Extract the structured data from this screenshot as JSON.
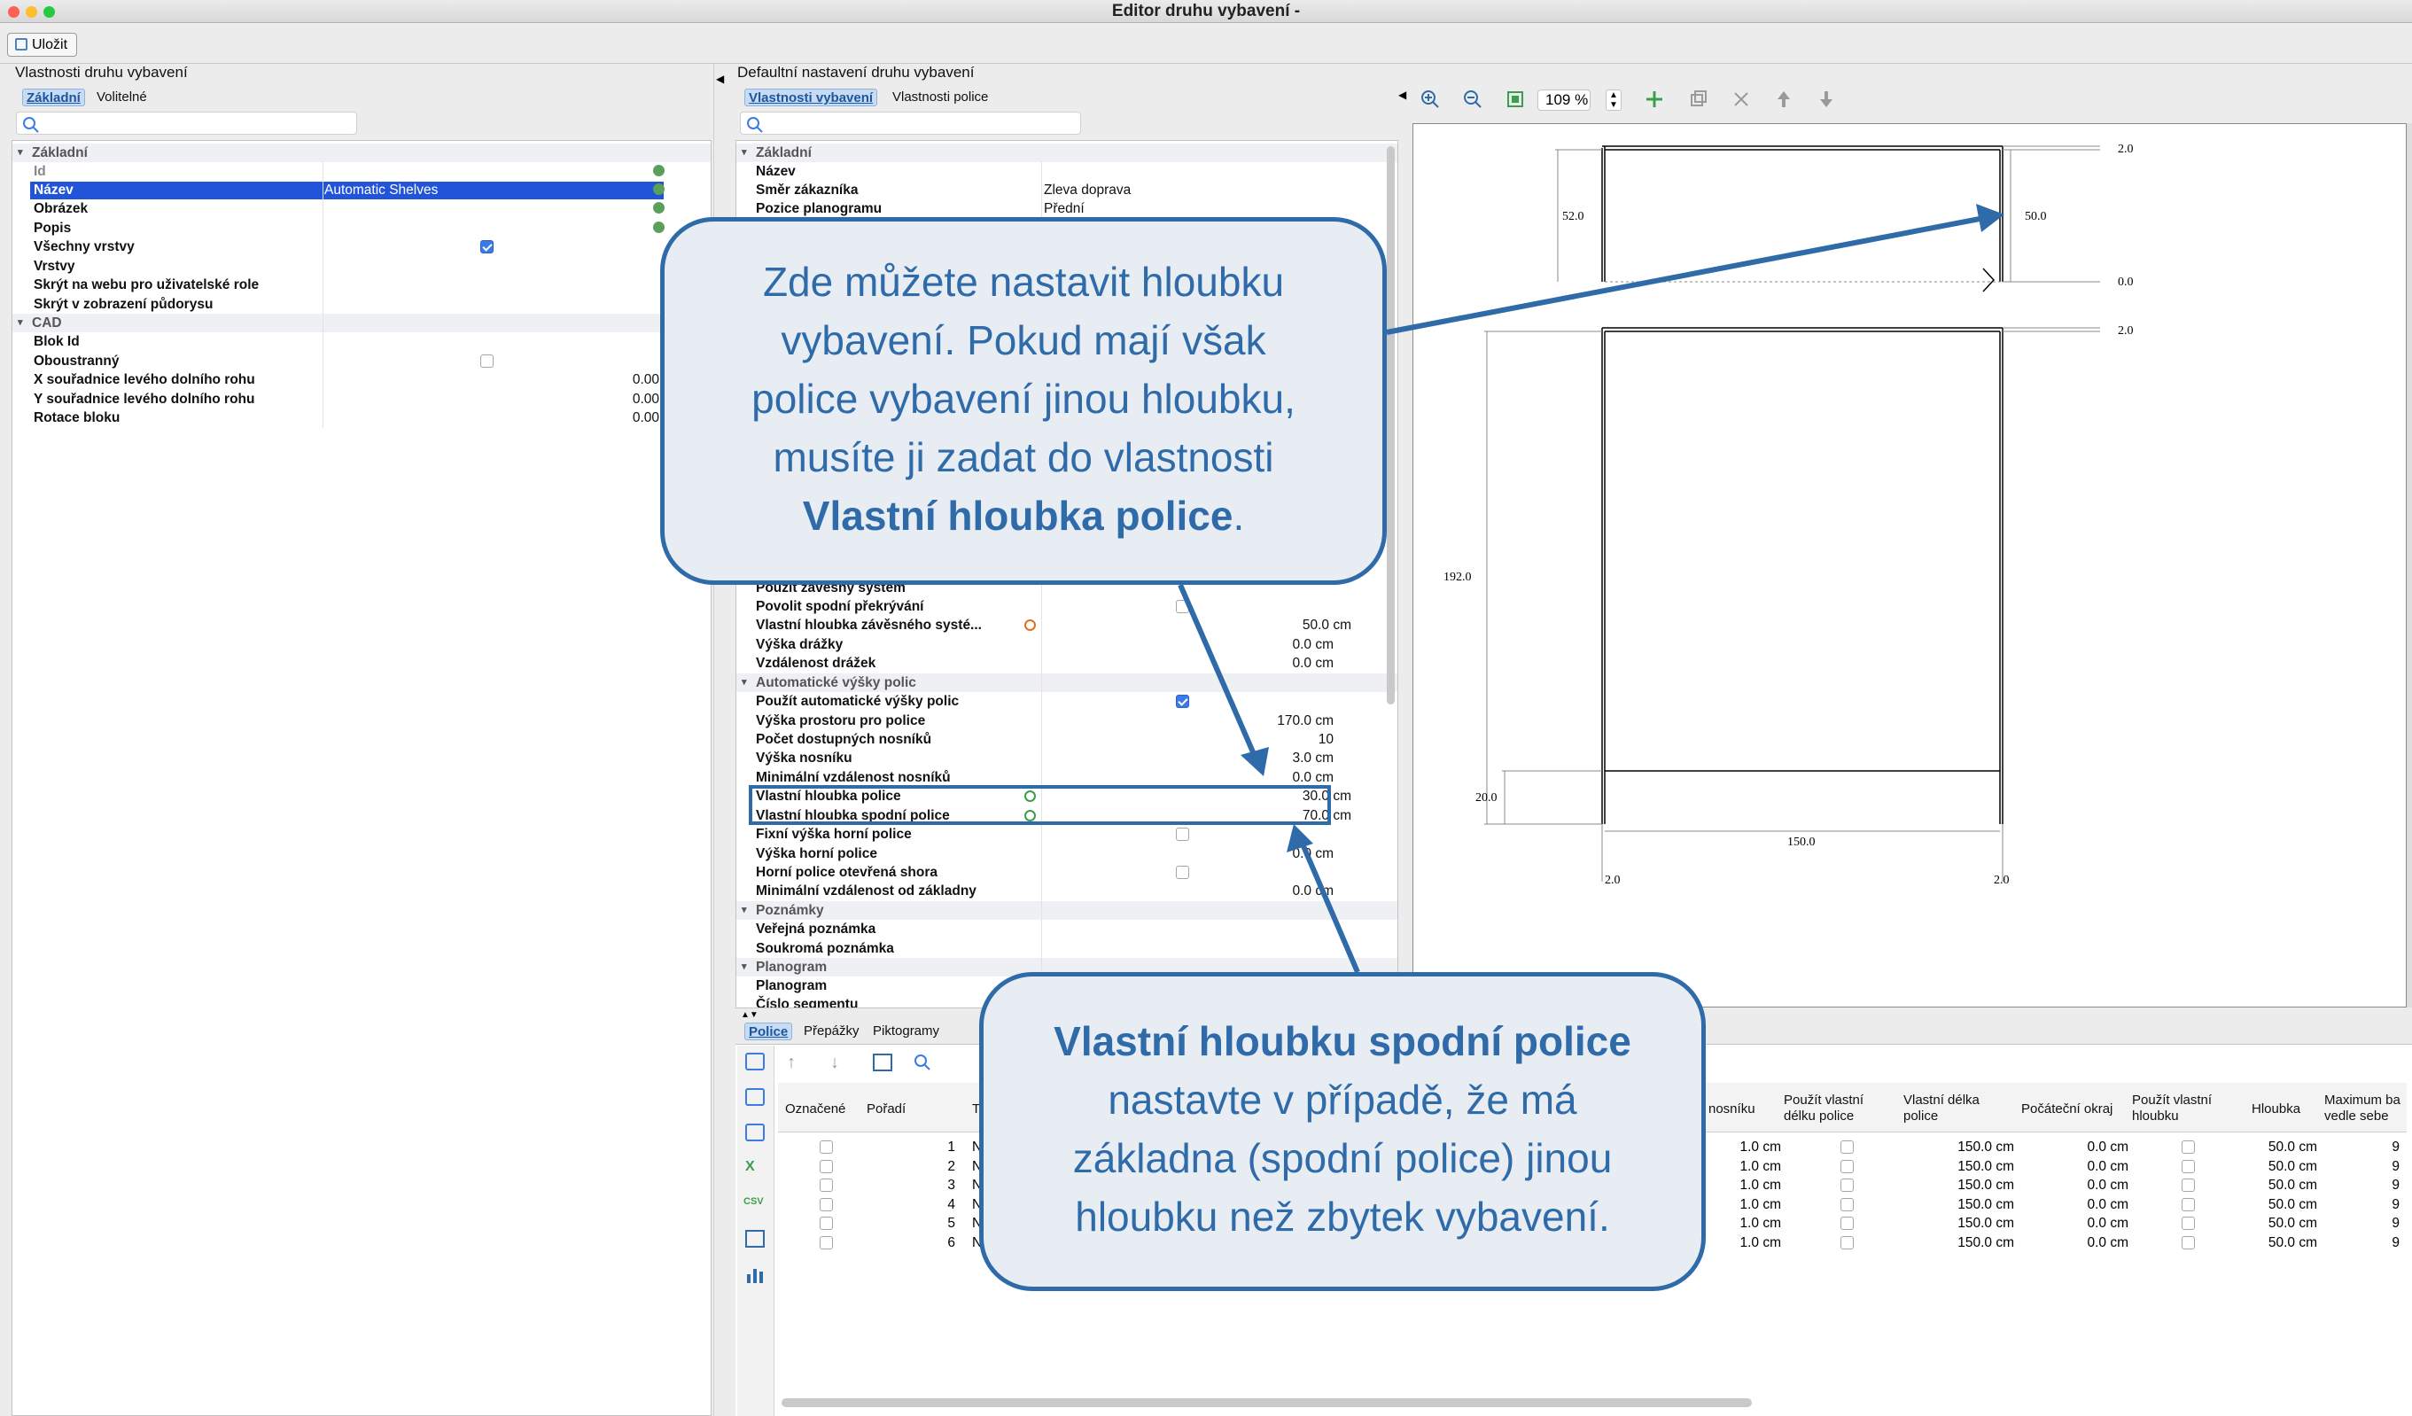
{
  "window": {
    "title": "Editor druhu vybavení -"
  },
  "toolbar": {
    "save_label": "Uložit"
  },
  "left": {
    "title": "Vlastnosti druhu vybavení",
    "tabs": [
      "Základní",
      "Volitelné"
    ],
    "groups": {
      "basic": "Základní",
      "cad": "CAD"
    },
    "rows": {
      "id": "Id",
      "name": "Název",
      "name_value": "Automatic Shelves",
      "image": "Obrázek",
      "desc": "Popis",
      "all_layers": "Všechny vrstvy",
      "layers": "Vrstvy",
      "hide_web": "Skrýt na webu pro uživatelské role",
      "hide_plan": "Skrýt v zobrazení půdorysu",
      "block_id": "Blok Id",
      "double_sided": "Oboustranný",
      "x_coord": "X souřadnice levého dolního rohu",
      "x_value": "0.00",
      "y_coord": "Y souřadnice levého dolního rohu",
      "y_value": "0.00",
      "rotation": "Rotace bloku",
      "rotation_value": "0.00"
    }
  },
  "middle": {
    "title": "Defaultní nastavení druhu vybavení",
    "tabs": [
      "Vlastnosti vybavení",
      "Vlastnosti police"
    ],
    "groups": {
      "basic": "Základní",
      "auto": "Automatické výšky polic",
      "notes": "Poznámky",
      "planogram": "Planogram"
    },
    "rows": {
      "name": "Název",
      "direction": "Směr zákazníka",
      "direction_value": "Zleva doprava",
      "position": "Pozice planogramu",
      "position_value": "Přední",
      "hanging_use": "Použít závěsný systém",
      "allow_overlap": "Povolit spodní překrývání",
      "own_depth_hanging": "Vlastní hloubka závěsného systé...",
      "own_depth_hanging_value": "50.0 cm",
      "groove_height": "Výška drážky",
      "groove_height_value": "0.0 cm",
      "groove_dist": "Vzdálenost drážek",
      "groove_dist_value": "0.0 cm",
      "use_auto": "Použít automatické výšky polic",
      "space_height": "Výška prostoru pro police",
      "space_height_value": "170.0 cm",
      "beams_count": "Počet dostupných nosníků",
      "beams_count_value": "10",
      "beam_height": "Výška nosníku",
      "beam_height_value": "3.0 cm",
      "min_beam_dist": "Minimální vzdálenost nosníků",
      "min_beam_dist_value": "0.0 cm",
      "shelf_depth": "Vlastní hloubka police",
      "shelf_depth_value": "30.0 cm",
      "bottom_depth": "Vlastní hloubka spodní police",
      "bottom_depth_value": "70.0 cm",
      "fixed_top": "Fixní výška horní police",
      "top_height": "Výška horní police",
      "top_height_value": "0.0 cm",
      "top_open": "Horní police otevřená shora",
      "min_base": "Minimální vzdálenost od základny",
      "min_base_value": "0.0 cm",
      "public_note": "Veřejná poznámka",
      "private_note": "Soukromá poznámka",
      "planogram": "Planogram",
      "segment": "Číslo segmentu"
    }
  },
  "viewer": {
    "zoom": "109 %",
    "dims": {
      "d1": "2.0",
      "d2": "52.0",
      "d3": "50.0",
      "d4": "0.0",
      "d5": "2.0",
      "d6": "192.0",
      "d7": "20.0",
      "d8": "150.0",
      "d9": "2.0",
      "d10": "2.0"
    }
  },
  "bottom": {
    "tabs": [
      "Police",
      "Přepážky",
      "Piktogramy"
    ],
    "columns": {
      "marked": "Označené",
      "order": "Pořadí",
      "t": "T",
      "beam": "nosníku",
      "use_len": "Použít vlastní délku police",
      "own_len": "Vlastní délka police",
      "start_edge": "Počáteční okraj",
      "use_depth": "Použít vlastní hloubku",
      "depth": "Hloubka",
      "max_side": "Maximum ba vedle sebe"
    },
    "rows": [
      {
        "order": "1",
        "t": "N",
        "beam": "1.0 cm",
        "len": "150.0 cm",
        "edge": "0.0 cm",
        "depth": "50.0 cm",
        "max": "9"
      },
      {
        "order": "2",
        "t": "N",
        "beam": "1.0 cm",
        "len": "150.0 cm",
        "edge": "0.0 cm",
        "depth": "50.0 cm",
        "max": "9"
      },
      {
        "order": "3",
        "t": "N",
        "beam": "1.0 cm",
        "len": "150.0 cm",
        "edge": "0.0 cm",
        "depth": "50.0 cm",
        "max": "9"
      },
      {
        "order": "4",
        "t": "N",
        "beam": "1.0 cm",
        "len": "150.0 cm",
        "edge": "0.0 cm",
        "depth": "50.0 cm",
        "max": "9"
      },
      {
        "order": "5",
        "t": "N",
        "beam": "1.0 cm",
        "len": "150.0 cm",
        "edge": "0.0 cm",
        "depth": "50.0 cm",
        "max": "9"
      },
      {
        "order": "6",
        "t": "N",
        "beam": "1.0 cm",
        "len": "150.0 cm",
        "edge": "0.0 cm",
        "depth": "50.0 cm",
        "max": "9"
      }
    ]
  },
  "callouts": {
    "top": {
      "l1": "Zde můžete nastavit hloubku",
      "l2": "vybavení. Pokud mají však",
      "l3": "police vybavení jinou hloubku,",
      "l4": "musíte ji zadat do vlastnosti",
      "bold": "Vlastní hloubka police",
      "end": "."
    },
    "bottom": {
      "bold": "Vlastní hloubku spodní police",
      "l2": "nastavte v případě, že má",
      "l3": "základna (spodní police) jinou",
      "l4": "hloubku než zbytek vybavení."
    }
  },
  "colors": {
    "accent": "#2f6aa9",
    "selection": "#2154d8",
    "callout_bg": "#e8edf4",
    "checkbox": "#3b7be5"
  }
}
